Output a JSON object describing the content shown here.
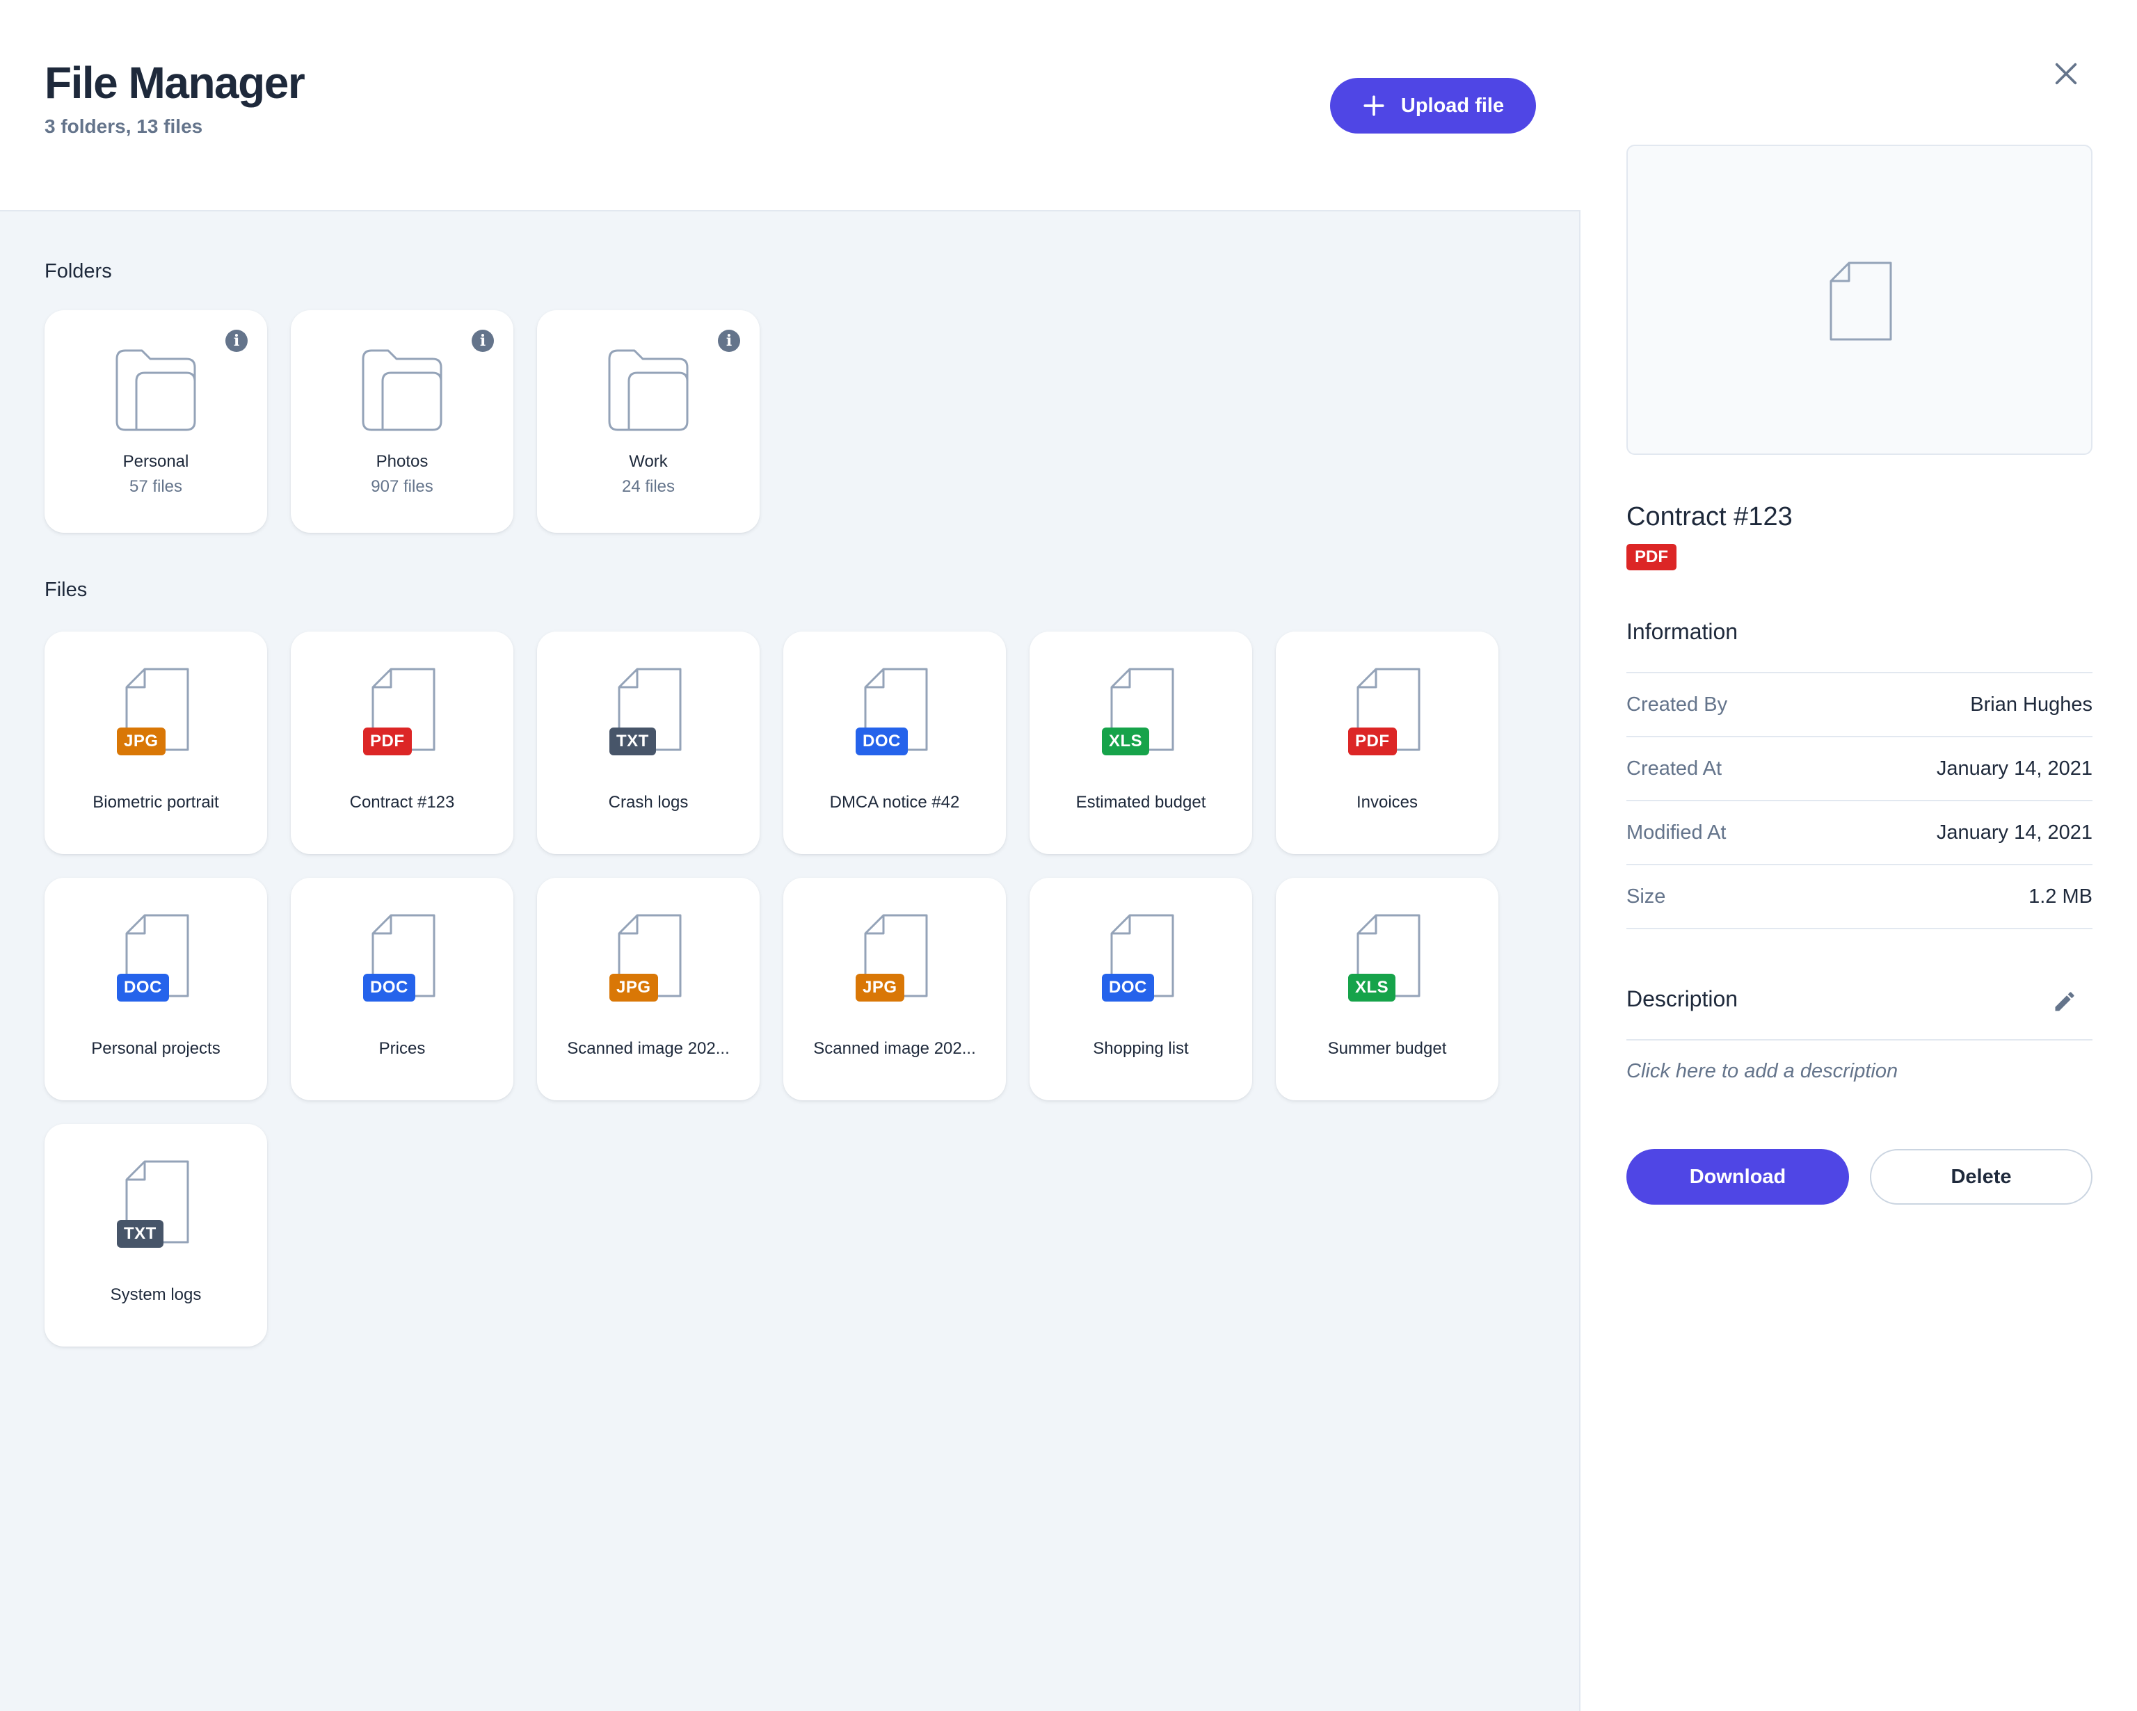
{
  "colors": {
    "accent": "#4f46e5",
    "badge_jpg": "#d97706",
    "badge_pdf": "#dc2626",
    "badge_txt": "#475569",
    "badge_doc": "#2563eb",
    "badge_xls": "#16a34a"
  },
  "header": {
    "title": "File Manager",
    "subtitle": "3 folders, 13 files",
    "upload_label": "Upload file",
    "upload_icon": "plus-icon"
  },
  "folders_label": "Folders",
  "folders": [
    {
      "name": "Personal",
      "count": "57 files",
      "icon": "folder-icon"
    },
    {
      "name": "Photos",
      "count": "907 files",
      "icon": "folder-icon"
    },
    {
      "name": "Work",
      "count": "24 files",
      "icon": "folder-icon"
    }
  ],
  "files_label": "Files",
  "files": [
    {
      "name": "Biometric portrait",
      "type": "JPG"
    },
    {
      "name": "Contract #123",
      "type": "PDF"
    },
    {
      "name": "Crash logs",
      "type": "TXT"
    },
    {
      "name": "DMCA notice #42",
      "type": "DOC"
    },
    {
      "name": "Estimated budget",
      "type": "XLS"
    },
    {
      "name": "Invoices",
      "type": "PDF"
    },
    {
      "name": "Personal projects",
      "type": "DOC"
    },
    {
      "name": "Prices",
      "type": "DOC"
    },
    {
      "name": "Scanned image 202...",
      "type": "JPG"
    },
    {
      "name": "Scanned image 202...",
      "type": "JPG"
    },
    {
      "name": "Shopping list",
      "type": "DOC"
    },
    {
      "name": "Summer budget",
      "type": "XLS"
    },
    {
      "name": "System logs",
      "type": "TXT"
    }
  ],
  "details": {
    "title": "Contract #123",
    "type": "PDF",
    "info_heading": "Information",
    "info": [
      {
        "label": "Created By",
        "value": "Brian Hughes"
      },
      {
        "label": "Created At",
        "value": "January 14, 2021"
      },
      {
        "label": "Modified At",
        "value": "January 14, 2021"
      },
      {
        "label": "Size",
        "value": "1.2 MB"
      }
    ],
    "description_heading": "Description",
    "description_placeholder": "Click here to add a description",
    "download_label": "Download",
    "delete_label": "Delete"
  }
}
